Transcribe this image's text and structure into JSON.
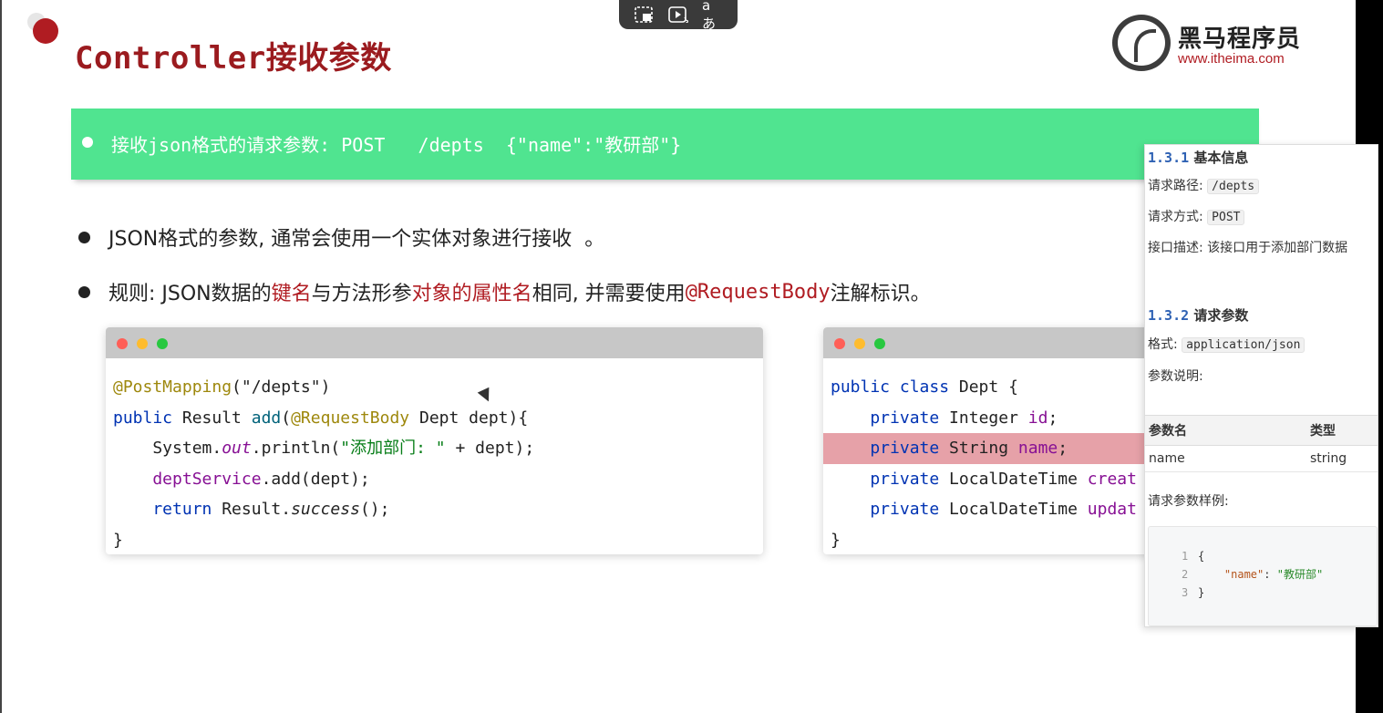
{
  "slide": {
    "title": "Controller接收参数",
    "banner_text": "接收json格式的请求参数: POST   /depts  {\"name\":\"教研部\"}",
    "bullet1": "JSON格式的参数, 通常会使用一个实体对象进行接收  。",
    "bullet2": {
      "p1": "规则: JSON数据的",
      "p2": "键名",
      "p3": "与方法形参",
      "p4": "对象的属性名",
      "p5": "相同, 并需要使用",
      "p6": "@RequestBody",
      "p7": "注解标识。"
    }
  },
  "brand": {
    "name": "黑马程序员",
    "url": "www.itheima.com"
  },
  "toolbar": {
    "icons": [
      "picture-in-picture-icon",
      "ai-play-icon",
      "translate-icon"
    ],
    "translate_glyph": "aあ"
  },
  "code_controller": {
    "l1_ann": "@PostMapping",
    "l1_rest": "(\"/depts\")",
    "l2_kw": "public",
    "l2_a": " Result ",
    "l2_fn": "add",
    "l2_b": "(",
    "l2_ann": "@RequestBody",
    "l2_c": " Dept dept){",
    "l3_a": "    System.",
    "l3_it": "out",
    "l3_b": ".println(",
    "l3_str": "\"添加部门: \"",
    "l3_c": " + dept);",
    "l4_fld": "    deptService",
    "l4_rest": ".add(dept);",
    "l5_kw": "    return",
    "l5_a": " Result.",
    "l5_it": "success",
    "l5_b": "();",
    "l6": "}"
  },
  "code_dept": {
    "l1_kw": "public class",
    "l1_rest": " Dept {",
    "l2_kw": "    private",
    "l2_type": " Integer ",
    "l2_fld": "id",
    "l2_end": ";",
    "l3_kw": "    private",
    "l3_type": " String ",
    "l3_fld": "name",
    "l3_end": ";",
    "l4_kw": "    private",
    "l4_type": " LocalDateTime ",
    "l4_fld": "creat",
    "l5_kw": "    private",
    "l5_type": " LocalDateTime ",
    "l5_fld": "updat",
    "l6": "}"
  },
  "api_doc": {
    "sec1_num": "1.3.1",
    "sec1_title": " 基本信息",
    "path_label": "请求路径: ",
    "path_value": "/depts",
    "method_label": "请求方式: ",
    "method_value": "POST",
    "desc": "接口描述: 该接口用于添加部门数据",
    "sec2_num": "1.3.2",
    "sec2_title": " 请求参数",
    "format_label": "格式: ",
    "format_value": "application/json",
    "param_desc_label": "参数说明:",
    "table_headers": [
      "参数名",
      "类型"
    ],
    "table_rows": [
      [
        "name",
        "string"
      ]
    ],
    "sample_label": "请求参数样例:",
    "sample": {
      "n1": "1",
      "t1": "{",
      "n2": "2",
      "key": "\"name\"",
      "colon": ": ",
      "val": "\"教研部\"",
      "n3": "3",
      "t3": "}"
    }
  }
}
